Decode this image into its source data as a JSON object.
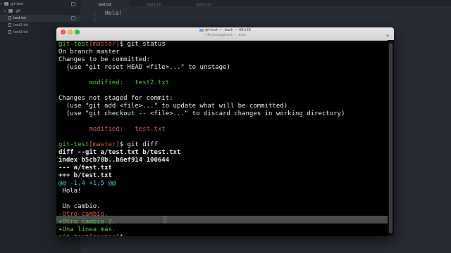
{
  "editor": {
    "sidebar": {
      "items": [
        {
          "label": "git-test",
          "kind": "folder"
        },
        {
          "label": ".git",
          "kind": "folder"
        },
        {
          "label": "test.txt",
          "kind": "file"
        },
        {
          "label": "test2.txt",
          "kind": "file"
        },
        {
          "label": "test3.txt",
          "kind": "file"
        }
      ]
    },
    "tabs": [
      {
        "label": "test.txt"
      },
      {
        "label": "test2.txt"
      },
      {
        "label": "test3.txt"
      }
    ],
    "code": {
      "line_numbers": [
        "1",
        "2"
      ],
      "lines": [
        "Hola!",
        ""
      ]
    }
  },
  "terminal": {
    "title": "git-test — -bash — 68×26",
    "subtitle": "~/Projects/git-test — -bash",
    "add_tab": "+",
    "colors": {
      "prompt_green": "#5fbf4e",
      "branch_red": "#cc5c4f",
      "diff_cyan": "#4fb8c9"
    },
    "lines": [
      {
        "prompt_dir": "git-test",
        "prompt_branch": "master",
        "prompt_cmd": "$ git status"
      },
      {
        "text": "On branch master"
      },
      {
        "text": "Changes to be committed:"
      },
      {
        "text": "  (use \"git reset HEAD <file>...\" to unstage)"
      },
      {
        "text": ""
      },
      {
        "text": "        modified:   test2.txt",
        "color": "green"
      },
      {
        "text": ""
      },
      {
        "text": "Changes not staged for commit:"
      },
      {
        "text": "  (use \"git add <file>...\" to update what will be committed)"
      },
      {
        "text": "  (use \"git checkout -- <file>...\" to discard changes in working directory)"
      },
      {
        "text": ""
      },
      {
        "text": "        modified:   test.txt",
        "color": "red"
      },
      {
        "text": ""
      },
      {
        "prompt_dir": "git-test",
        "prompt_branch": "master",
        "prompt_cmd": "$ git diff"
      },
      {
        "text": "diff --git a/test.txt b/test.txt",
        "bold": true
      },
      {
        "text": "index b5cb78b..b6ef914 100644",
        "bold": true
      },
      {
        "text": "--- a/test.txt",
        "bold": true
      },
      {
        "text": "+++ b/test.txt",
        "bold": true
      },
      {
        "text": "@@ -1,4 +1,5 @@",
        "color": "cyan"
      },
      {
        "text": " Hola!"
      },
      {
        "text": ""
      },
      {
        "text": " Un cambio."
      },
      {
        "text": "-Otro cambio.",
        "color": "red"
      },
      {
        "text": "+Otro cambio 2.",
        "color": "green"
      },
      {
        "text": "+Una línea más.",
        "color": "green"
      },
      {
        "prompt_dir": "git-test",
        "prompt_branch": "master",
        "prompt_cmd": "$"
      }
    ]
  }
}
